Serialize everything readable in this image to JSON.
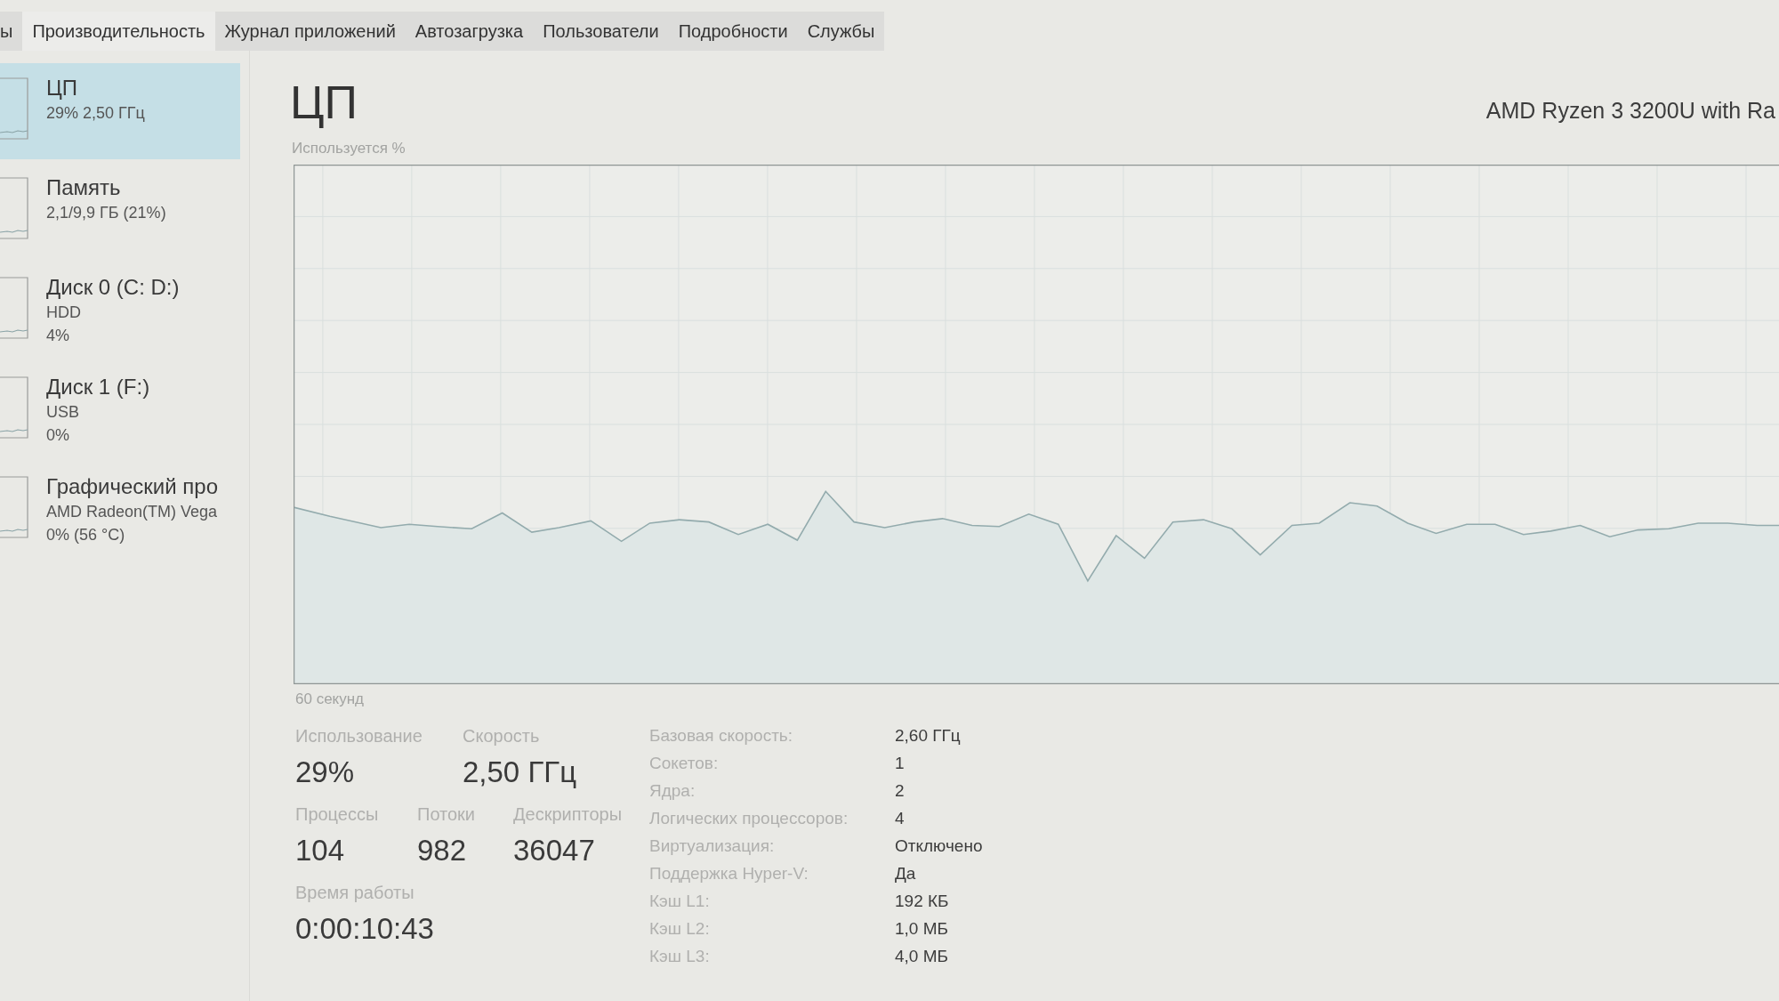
{
  "tabs": [
    {
      "label": "ы",
      "selected": false
    },
    {
      "label": "Производительность",
      "selected": true
    },
    {
      "label": "Журнал приложений",
      "selected": false
    },
    {
      "label": "Автозагрузка",
      "selected": false
    },
    {
      "label": "Пользователи",
      "selected": false
    },
    {
      "label": "Подробности",
      "selected": false
    },
    {
      "label": "Службы",
      "selected": false
    }
  ],
  "sidebar": {
    "items": [
      {
        "name": "ЦП",
        "details": [
          "29% 2,50 ГГц"
        ],
        "selected": true
      },
      {
        "name": "Память",
        "details": [
          "2,1/9,9 ГБ (21%)"
        ],
        "selected": false
      },
      {
        "name": "Диск 0 (C: D:)",
        "details": [
          "HDD",
          "4%"
        ],
        "selected": false
      },
      {
        "name": "Диск 1 (F:)",
        "details": [
          "USB",
          "0%"
        ],
        "selected": false
      },
      {
        "name": "Графический про",
        "details": [
          "AMD Radeon(TM) Vega",
          "0% (56 °C)"
        ],
        "selected": false
      }
    ]
  },
  "panel": {
    "title": "ЦП",
    "device": "AMD Ryzen 3 3200U with Ra",
    "graph": {
      "ylabel": "Используется %",
      "xlabel": "60 секунд"
    },
    "stats": [
      [
        {
          "label": "Использование",
          "value": "29%"
        },
        {
          "label": "Скорость",
          "value": "2,50 ГГц"
        }
      ],
      [
        {
          "label": "Процессы",
          "value": "104"
        },
        {
          "label": "Потоки",
          "value": "982"
        },
        {
          "label": "Дескрипторы",
          "value": "36047"
        }
      ],
      [
        {
          "label": "Время работы",
          "value": "0:00:10:43"
        }
      ]
    ],
    "specs": [
      {
        "label": "Базовая скорость:",
        "value": "2,60 ГГц"
      },
      {
        "label": "Сокетов:",
        "value": "1"
      },
      {
        "label": "Ядра:",
        "value": "2"
      },
      {
        "label": "Логических процессоров:",
        "value": "4"
      },
      {
        "label": "Виртуализация:",
        "value": "Отключено"
      },
      {
        "label": "Поддержка Hyper-V:",
        "value": "Да"
      },
      {
        "label": "Кэш L1:",
        "value": "192 КБ"
      },
      {
        "label": "Кэш L2:",
        "value": "1,0 МБ"
      },
      {
        "label": "Кэш L3:",
        "value": "4,0 МБ"
      }
    ]
  }
}
